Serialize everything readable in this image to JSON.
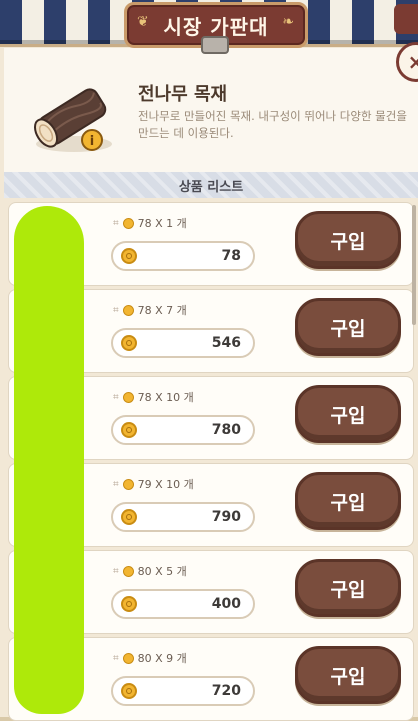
{
  "window": {
    "title": "시장 가판대",
    "title_deco_left": "❦",
    "title_deco_right": "❧",
    "close_label": "×"
  },
  "item": {
    "name": "전나무 목재",
    "description": "전나무로 만들어진 목재. 내구성이 뛰어나 다양한 물건을 만드는 데 이용된다.",
    "info_badge": "i",
    "icon": "log-icon"
  },
  "list": {
    "header": "상품 리스트",
    "buy_label": "구입",
    "rows": [
      {
        "unit_price": "78",
        "qty_text": "78 X 1 개",
        "total": "78"
      },
      {
        "unit_price": "78",
        "qty_text": "78 X 7 개",
        "total": "546"
      },
      {
        "unit_price": "78",
        "qty_text": "78 X 10 개",
        "total": "780"
      },
      {
        "unit_price": "79",
        "qty_text": "79 X 10 개",
        "total": "790"
      },
      {
        "unit_price": "80",
        "qty_text": "80 X 5 개",
        "total": "400"
      },
      {
        "unit_price": "80",
        "qty_text": "80 X 9 개",
        "total": "720"
      }
    ]
  },
  "colors": {
    "brand_brown": "#7b3b32",
    "buy_button": "#7a4d3d",
    "coin": "#f2b531",
    "redaction": "#aee90a"
  }
}
